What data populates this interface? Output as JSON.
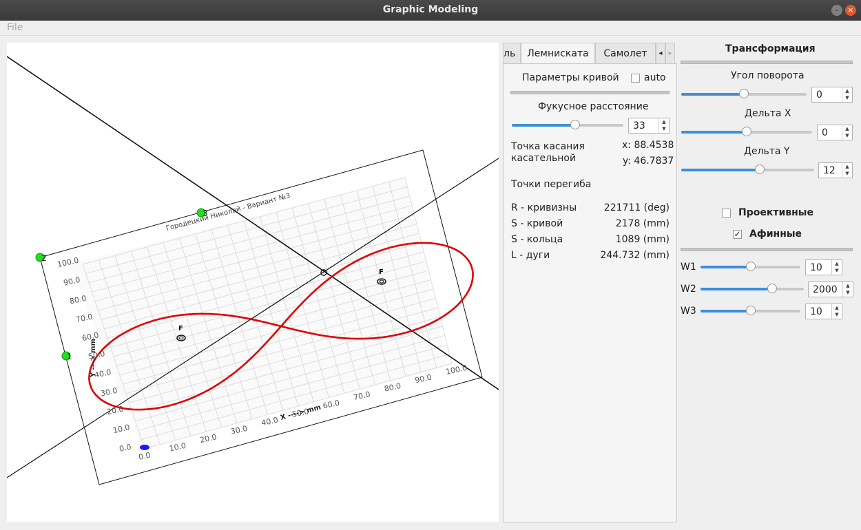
{
  "window": {
    "title": "Graphic Modeling",
    "btn_min": "–",
    "btn_max": "□",
    "btn_close": "×"
  },
  "menu": {
    "file": "File"
  },
  "tabs": {
    "partial": "ль",
    "lemniscate": "Лемниската",
    "plane": "Самолет",
    "left": "◂",
    "right": "▸"
  },
  "curve": {
    "params_label": "Параметры кривой",
    "auto_label": "auto",
    "auto_checked": false,
    "focal_label": "Фукусное расстояние",
    "focal_value": "33",
    "focal_fraction": 0.57,
    "tangent_label_1": "Точка касания",
    "tangent_label_2": "касательной",
    "tangent_x": "x: 88.4538",
    "tangent_y": "y: 46.7837",
    "inflection_label": "Точки перегиба",
    "stats": [
      {
        "label": "R - кривизны",
        "value": "221711 (deg)"
      },
      {
        "label": "S - кривой",
        "value": "2178 (mm)"
      },
      {
        "label": "S - кольца",
        "value": "1089 (mm)"
      },
      {
        "label": "L - дуги",
        "value": "244.732 (mm)"
      }
    ]
  },
  "transform": {
    "title": "Трансформация",
    "rotation_label": "Угол поворота",
    "rotation_value": "0",
    "rotation_fraction": 0.5,
    "dx_label": "Дельта X",
    "dx_value": "0",
    "dx_fraction": 0.5,
    "dy_label": "Дельта  Y",
    "dy_value": "12",
    "dy_fraction": 0.59,
    "projective_label": "Проективные",
    "projective_checked": false,
    "affine_label": "Афинные",
    "affine_checked": true,
    "w1_label": "W1",
    "w1_value": "10",
    "w1_fraction": 0.5,
    "w2_label": "W2",
    "w2_value": "2000",
    "w2_fraction": 0.69,
    "w3_label": "W3",
    "w3_value": "10",
    "w3_fraction": 0.5
  },
  "plot": {
    "title": "Городецкий Николай - Вариант №3",
    "xlabel": "X ----> mm",
    "ylabel": "Y ---> mm",
    "ticks": [
      "0.0",
      "10.0",
      "20.0",
      "30.0",
      "40.0",
      "50.0",
      "60.0",
      "70.0",
      "80.0",
      "90.0",
      "100.0"
    ],
    "focus_label": "F",
    "point_labels": [
      "1",
      "2",
      "3"
    ],
    "curve_color": "#e00000",
    "handle_color": "#00dd00",
    "origin_color": "#0000ff"
  }
}
